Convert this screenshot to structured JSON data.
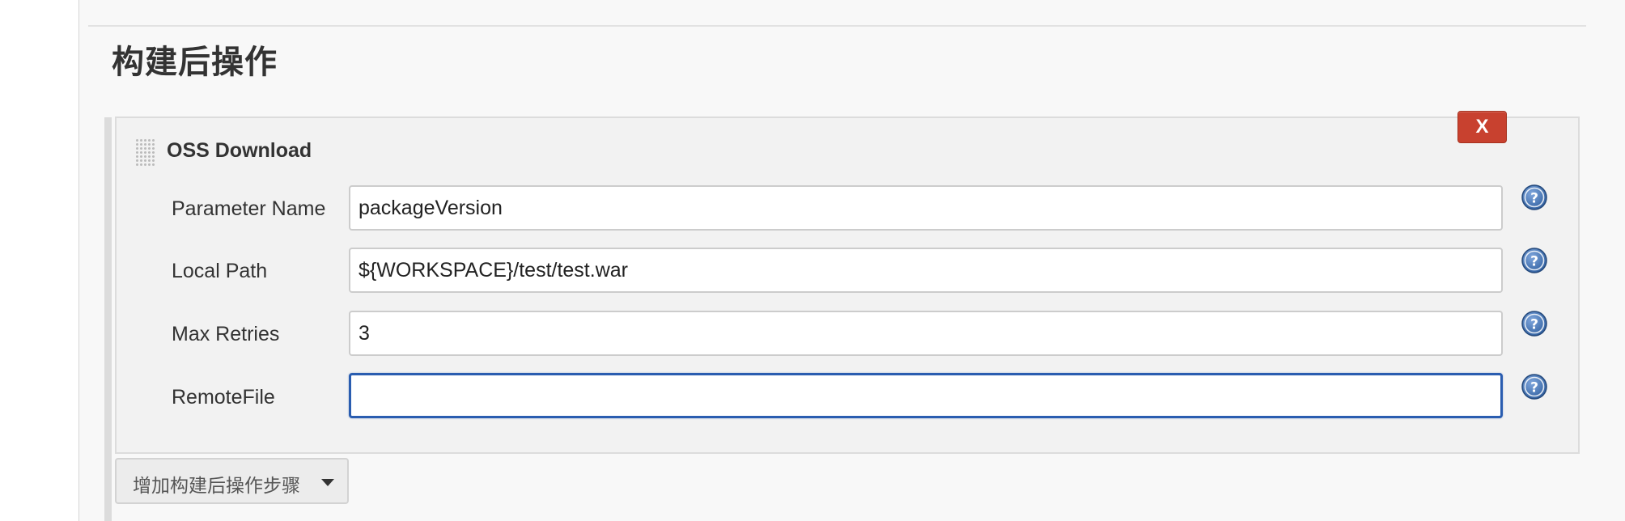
{
  "section": {
    "title": "构建后操作"
  },
  "step": {
    "title": "OSS Download",
    "delete_label": "X",
    "fields": [
      {
        "label": "Parameter Name",
        "value": "packageVersion",
        "placeholder": "",
        "icon": "help-icon"
      },
      {
        "label": "Local Path",
        "value": "${WORKSPACE}/test/test.war",
        "placeholder": "",
        "icon": "help-icon"
      },
      {
        "label": "Max Retries",
        "value": "3",
        "placeholder": "",
        "icon": "help-icon"
      },
      {
        "label": "RemoteFile",
        "value": "",
        "placeholder": "",
        "icon": "help-icon",
        "focused": true
      }
    ]
  },
  "add_step": {
    "label": "增加构建后操作步骤",
    "icon": "chevron-down-icon"
  },
  "colors": {
    "delete_button": "#c8412f",
    "focus_border": "#2a5db0",
    "help_icon": "#3a6fb5",
    "panel_background": "#f8f8f8",
    "card_background": "#f2f2f2"
  }
}
